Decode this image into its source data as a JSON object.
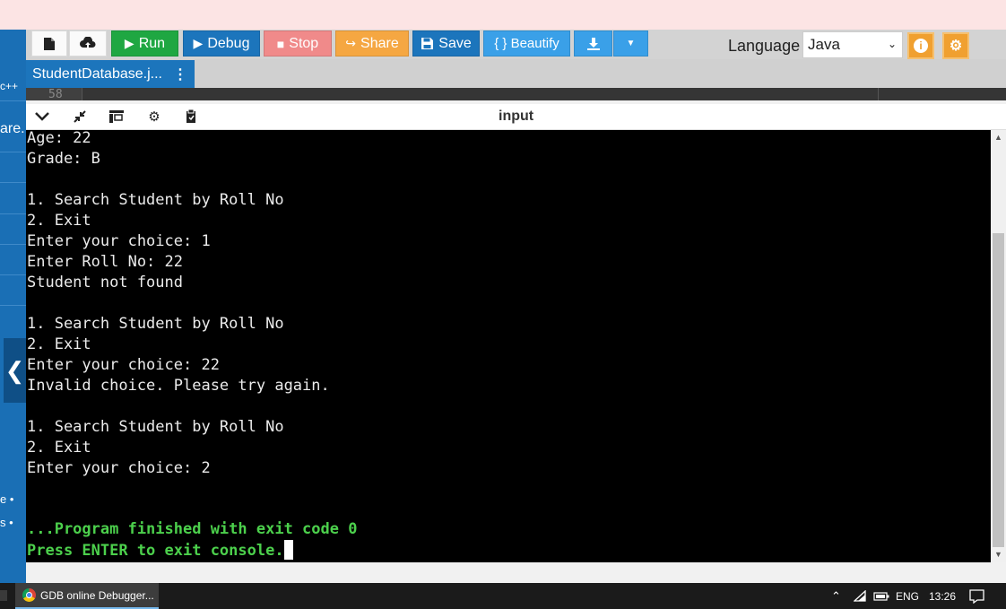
{
  "toolbar": {
    "run_label": "Run",
    "debug_label": "Debug",
    "stop_label": "Stop",
    "share_label": "Share",
    "save_label": "Save",
    "beautify_label": "{ } Beautify",
    "language_label": "Language",
    "language_value": "Java"
  },
  "editor": {
    "file_tab": "StudentDatabase.j...",
    "line_number": "58"
  },
  "sidebar": {
    "text_1": "c++",
    "text_2": "are.",
    "text_3": "e •",
    "text_4": "s •"
  },
  "console": {
    "header_title": "input",
    "output": "Age: 22\nGrade: B\n\n1. Search Student by Roll No\n2. Exit\nEnter your choice: 1\nEnter Roll No: 22\nStudent not found\n\n1. Search Student by Roll No\n2. Exit\nEnter your choice: 22\nInvalid choice. Please try again.\n\n1. Search Student by Roll No\n2. Exit\nEnter your choice: 2",
    "finish_line_1": "...Program finished with exit code 0",
    "finish_line_2": "Press ENTER to exit console."
  },
  "taskbar": {
    "app_label": "GDB online Debugger...",
    "language_indicator": "ENG",
    "clock": "13:26"
  },
  "colors": {
    "run": "#1fa742",
    "debug": "#1c75bc",
    "stop": "#f08a8a",
    "share": "#f5a742",
    "save": "#1c75bc",
    "beautify": "#3aa0e8",
    "download": "#3aa0e8",
    "accent_orange": "#f0a030",
    "finish_text": "#4cd04c"
  },
  "icons": [
    "new-file-icon",
    "upload-icon",
    "play-icon",
    "debug-icon",
    "stop-icon",
    "share-icon",
    "save-icon",
    "download-icon",
    "caret-down-icon",
    "info-icon",
    "gear-icon",
    "chevron-down-icon",
    "resize-icon",
    "layout-icon",
    "settings-icon",
    "clipboard-icon",
    "chrome-icon",
    "wifi-icon",
    "battery-icon",
    "notification-icon"
  ]
}
